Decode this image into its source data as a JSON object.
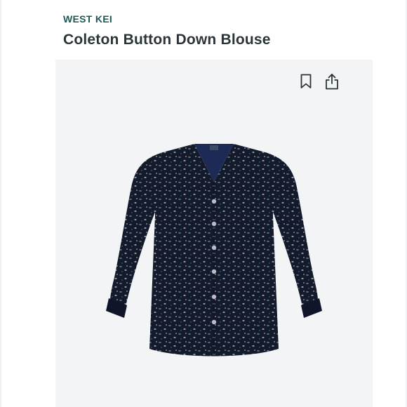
{
  "product": {
    "brand": "WEST KEI",
    "title": "Coleton Button Down Blouse"
  },
  "actions": {
    "bookmark_icon": "bookmark-icon",
    "share_icon": "share-icon"
  },
  "image": {
    "description_colors": {
      "fabric": "#151a2b",
      "collar_lining": "#1d2a55",
      "print": "#6f8fa0",
      "background": "#f3f4f5"
    }
  }
}
